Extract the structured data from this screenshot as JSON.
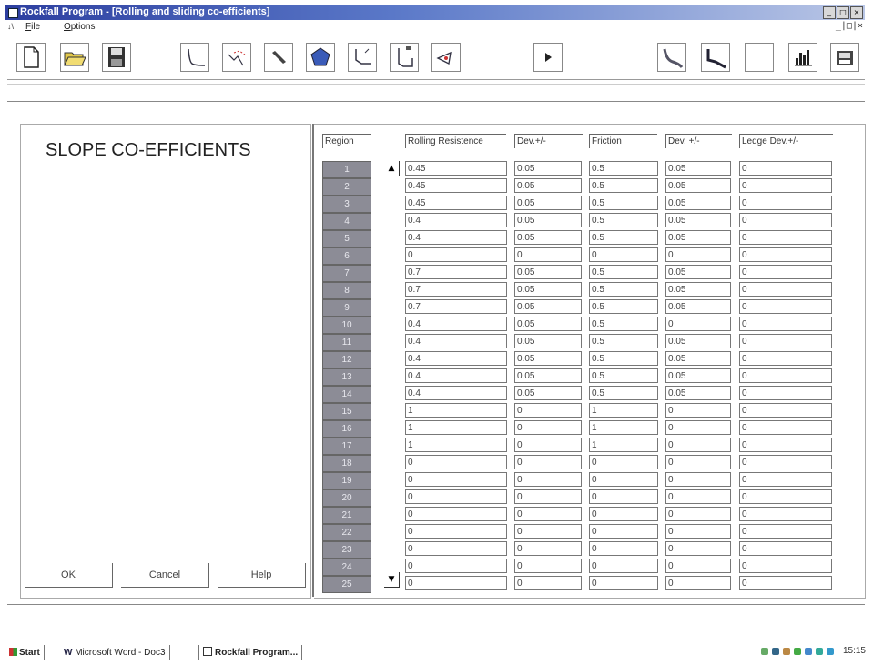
{
  "window": {
    "title": "Rockfall Program - [Rolling and sliding co-efficients]",
    "controls": [
      "_",
      "□",
      "×"
    ],
    "mdi_controls": "_|□|×"
  },
  "menu": {
    "system": "↓\\",
    "items": [
      "File",
      "Options"
    ]
  },
  "toolbar": {
    "buttons": [
      {
        "name": "new-file-icon"
      },
      {
        "name": "open-folder-icon"
      },
      {
        "name": "save-disk-icon"
      },
      {
        "name": "slope-profile-icon"
      },
      {
        "name": "rock-path-icon"
      },
      {
        "name": "pen-icon"
      },
      {
        "name": "rock-icon"
      },
      {
        "name": "barrier-icon"
      },
      {
        "name": "fence-icon"
      },
      {
        "name": "wedge-icon"
      },
      {
        "name": "run-arrow-icon"
      },
      {
        "name": "trajectory-icon"
      },
      {
        "name": "trajectory-alt-icon"
      },
      {
        "name": "blank-icon"
      },
      {
        "name": "histogram-icon"
      },
      {
        "name": "printer-icon"
      }
    ]
  },
  "dialog": {
    "title": "SLOPE CO-EFFICIENTS",
    "ok_label": "OK",
    "cancel_label": "Cancel",
    "help_label": "Help"
  },
  "table": {
    "headers": [
      "Region",
      "Rolling Resistence",
      "Dev.+/-",
      "Friction",
      "Dev. +/-",
      "Ledge Dev.+/-"
    ],
    "rows": [
      {
        "region": "1",
        "rolling": "0.45",
        "dev1": "0.05",
        "friction": "0.5",
        "dev2": "0.05",
        "ledge": "0"
      },
      {
        "region": "2",
        "rolling": "0.45",
        "dev1": "0.05",
        "friction": "0.5",
        "dev2": "0.05",
        "ledge": "0"
      },
      {
        "region": "3",
        "rolling": "0.45",
        "dev1": "0.05",
        "friction": "0.5",
        "dev2": "0.05",
        "ledge": "0"
      },
      {
        "region": "4",
        "rolling": "0.4",
        "dev1": "0.05",
        "friction": "0.5",
        "dev2": "0.05",
        "ledge": "0"
      },
      {
        "region": "5",
        "rolling": "0.4",
        "dev1": "0.05",
        "friction": "0.5",
        "dev2": "0.05",
        "ledge": "0"
      },
      {
        "region": "6",
        "rolling": "0",
        "dev1": "0",
        "friction": "0",
        "dev2": "0",
        "ledge": "0"
      },
      {
        "region": "7",
        "rolling": "0.7",
        "dev1": "0.05",
        "friction": "0.5",
        "dev2": "0.05",
        "ledge": "0"
      },
      {
        "region": "8",
        "rolling": "0.7",
        "dev1": "0.05",
        "friction": "0.5",
        "dev2": "0.05",
        "ledge": "0"
      },
      {
        "region": "9",
        "rolling": "0.7",
        "dev1": "0.05",
        "friction": "0.5",
        "dev2": "0.05",
        "ledge": "0"
      },
      {
        "region": "10",
        "rolling": "0.4",
        "dev1": "0.05",
        "friction": "0.5",
        "dev2": "0",
        "ledge": "0"
      },
      {
        "region": "11",
        "rolling": "0.4",
        "dev1": "0.05",
        "friction": "0.5",
        "dev2": "0.05",
        "ledge": "0"
      },
      {
        "region": "12",
        "rolling": "0.4",
        "dev1": "0.05",
        "friction": "0.5",
        "dev2": "0.05",
        "ledge": "0"
      },
      {
        "region": "13",
        "rolling": "0.4",
        "dev1": "0.05",
        "friction": "0.5",
        "dev2": "0.05",
        "ledge": "0"
      },
      {
        "region": "14",
        "rolling": "0.4",
        "dev1": "0.05",
        "friction": "0.5",
        "dev2": "0.05",
        "ledge": "0"
      },
      {
        "region": "15",
        "rolling": "1",
        "dev1": "0",
        "friction": "1",
        "dev2": "0",
        "ledge": "0"
      },
      {
        "region": "16",
        "rolling": "1",
        "dev1": "0",
        "friction": "1",
        "dev2": "0",
        "ledge": "0"
      },
      {
        "region": "17",
        "rolling": "1",
        "dev1": "0",
        "friction": "1",
        "dev2": "0",
        "ledge": "0"
      },
      {
        "region": "18",
        "rolling": "0",
        "dev1": "0",
        "friction": "0",
        "dev2": "0",
        "ledge": "0"
      },
      {
        "region": "19",
        "rolling": "0",
        "dev1": "0",
        "friction": "0",
        "dev2": "0",
        "ledge": "0"
      },
      {
        "region": "20",
        "rolling": "0",
        "dev1": "0",
        "friction": "0",
        "dev2": "0",
        "ledge": "0"
      },
      {
        "region": "21",
        "rolling": "0",
        "dev1": "0",
        "friction": "0",
        "dev2": "0",
        "ledge": "0"
      },
      {
        "region": "22",
        "rolling": "0",
        "dev1": "0",
        "friction": "0",
        "dev2": "0",
        "ledge": "0"
      },
      {
        "region": "23",
        "rolling": "0",
        "dev1": "0",
        "friction": "0",
        "dev2": "0",
        "ledge": "0"
      },
      {
        "region": "24",
        "rolling": "0",
        "dev1": "0",
        "friction": "0",
        "dev2": "0",
        "ledge": "0"
      },
      {
        "region": "25",
        "rolling": "0",
        "dev1": "0",
        "friction": "0",
        "dev2": "0",
        "ledge": "0"
      }
    ],
    "scroll_up": "▲",
    "scroll_down": "▼"
  },
  "taskbar": {
    "start_label": "Start",
    "tasks": [
      "Microsoft Word - Doc3",
      "Rockfall Program..."
    ],
    "clock": "15:15"
  },
  "colors": {
    "title_start": "#2d3fa0",
    "title_end": "#b9c6e6",
    "region_cell": "#8c8c96"
  }
}
